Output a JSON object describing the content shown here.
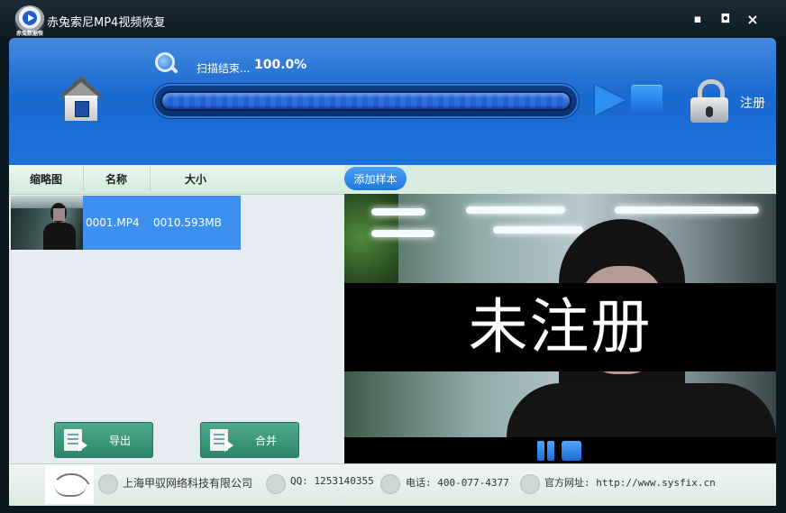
{
  "window": {
    "title": "赤兔索尼MP4视频恢复",
    "logo_caption": "赤兔数据恢复",
    "minimize": "▪",
    "restore": "◘",
    "close": "×"
  },
  "header": {
    "status_text": "扫描结束...",
    "progress_text": "100.0%",
    "progress_value": 100,
    "register_label": "注册"
  },
  "table": {
    "columns": [
      "缩略图",
      "名称",
      "大小"
    ],
    "rows": [
      {
        "name": "0001.MP4",
        "size": "0010.593MB"
      }
    ]
  },
  "actions": {
    "export_label": "导出",
    "merge_label": "合并"
  },
  "preview": {
    "add_sample_label": "添加样本",
    "watermark_text": "未注册"
  },
  "footer": {
    "company": "上海甲驭网络科技有限公司",
    "qq": "QQ: 1253140355",
    "phone": "电话: 400-077-4377",
    "website": "官方网址: http://www.sysfix.cn"
  },
  "colors": {
    "accent": "#1d6fd6",
    "row_selected": "#3d8ff0",
    "button_green": "#2d8669"
  }
}
